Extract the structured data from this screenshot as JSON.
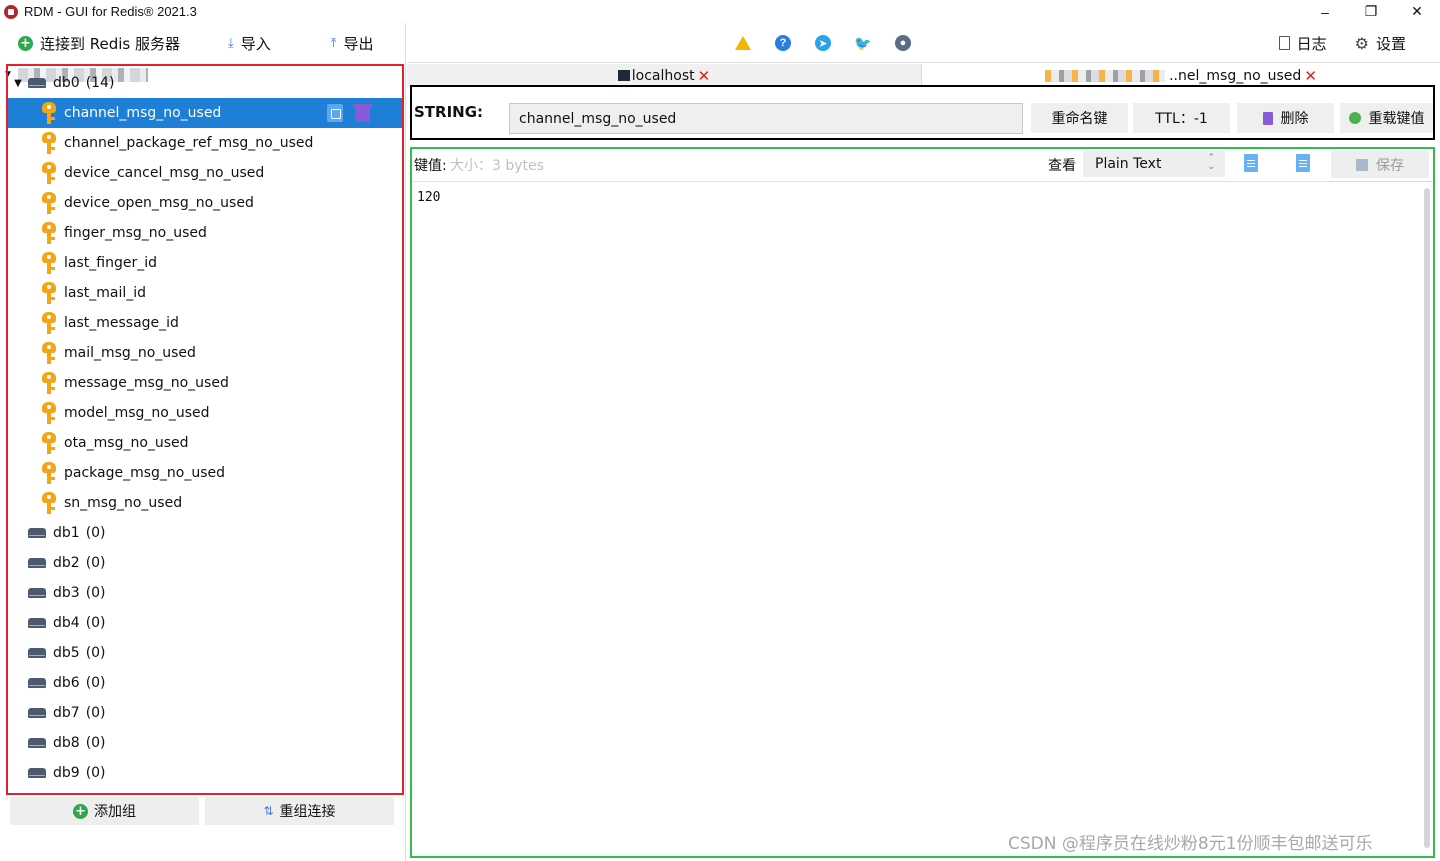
{
  "window": {
    "title": "RDM - GUI for Redis® 2021.3",
    "minimize": "–",
    "restore": "❐",
    "close": "✕"
  },
  "left_toolbar": {
    "connect": "连接到 Redis 服务器",
    "import": "导入",
    "export": "导出"
  },
  "tree": {
    "db0": {
      "name": "db0",
      "count": "(14)"
    },
    "keys": [
      "channel_msg_no_used",
      "channel_package_ref_msg_no_used",
      "device_cancel_msg_no_used",
      "device_open_msg_no_used",
      "finger_msg_no_used",
      "last_finger_id",
      "last_mail_id",
      "last_message_id",
      "mail_msg_no_used",
      "message_msg_no_used",
      "model_msg_no_used",
      "ota_msg_no_used",
      "package_msg_no_used",
      "sn_msg_no_used"
    ],
    "dbs": [
      {
        "name": "db1",
        "count": "(0)"
      },
      {
        "name": "db2",
        "count": "(0)"
      },
      {
        "name": "db3",
        "count": "(0)"
      },
      {
        "name": "db4",
        "count": "(0)"
      },
      {
        "name": "db5",
        "count": "(0)"
      },
      {
        "name": "db6",
        "count": "(0)"
      },
      {
        "name": "db7",
        "count": "(0)"
      },
      {
        "name": "db8",
        "count": "(0)"
      },
      {
        "name": "db9",
        "count": "(0)"
      }
    ]
  },
  "left_bottom": {
    "add_group": "添加组",
    "regroup": "重组连接"
  },
  "right_toolbar": {
    "log": "日志",
    "settings": "设置"
  },
  "tabs": {
    "tab1_label": "localhost",
    "tab2_label": "..nel_msg_no_used",
    "close_glyph": "✕"
  },
  "key_header": {
    "type_label": "STRING:",
    "key_name": "channel_msg_no_used",
    "rename": "重命名键",
    "ttl": "TTL：-1",
    "delete": "删除",
    "reload": "重载键值"
  },
  "value_bar": {
    "label": "键值:",
    "size": "大小：3 bytes",
    "view_label": "查看",
    "format": "Plain Text",
    "save": "保存"
  },
  "value": "120",
  "watermark": "CSDN @程序员在线炒粉8元1份顺丰包邮送可乐",
  "colors": {
    "selection": "#1d7fd6",
    "tree_frame": "#e0222a",
    "header_frame": "#000000",
    "value_frame": "#2fbf4a",
    "key_icon": "#f2a516"
  }
}
